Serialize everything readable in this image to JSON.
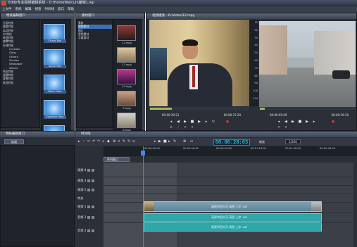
{
  "window": {
    "title": "Edify专业视频编辑系统 - D:\\HomeWatcun\\编辑1.wp"
  },
  "menu": [
    "上文件",
    "系统",
    "编辑",
    "视窗",
    "时间线",
    "窗口",
    "帮助"
  ],
  "effects_panel": {
    "title": "特技编辑窗口",
    "tree": [
      {
        "label": "分层特技",
        "sub": false
      },
      {
        "label": "速度特技",
        "sub": false
      },
      {
        "label": "运动特技",
        "sub": false
      },
      {
        "label": "3D特技",
        "sub": false
      },
      {
        "label": "转场特技",
        "sub": false
      },
      {
        "label": "遮罩特技",
        "sub": false
      },
      {
        "label": "光线特技",
        "sub": false
      },
      {
        "label": "Crystals",
        "sub": true
      },
      {
        "label": "Glass",
        "sub": true
      },
      {
        "label": "Others",
        "sub": true
      },
      {
        "label": "Strokes",
        "sub": true
      },
      {
        "label": "Wallpaper",
        "sub": true
      },
      {
        "label": "Waves",
        "sub": true
      },
      {
        "label": "色彩特技",
        "sub": false
      },
      {
        "label": "滤镜特技",
        "sub": false
      },
      {
        "label": "背景特技",
        "sub": false
      },
      {
        "label": "其他特技",
        "sub": false
      }
    ],
    "thumbs": [
      "Chaos Box",
      "Spiral Ball",
      "Black Hole",
      "Explosion Box",
      ""
    ]
  },
  "material_panel": {
    "title": "素材窗口",
    "tree": [
      {
        "label": "素材",
        "selected": false
      },
      {
        "label": "视频素材",
        "selected": true
      },
      {
        "label": "图片",
        "selected": false
      },
      {
        "label": "音频素材",
        "selected": false
      },
      {
        "label": "字幕素材",
        "selected": false
      }
    ],
    "thumbs": [
      "12.mpg",
      "11.mpg",
      "10.mpg",
      "9.mpg",
      "8.mpg"
    ]
  },
  "preview": {
    "title": "视频播放 - D:\\Video\\12.mpg",
    "left_timecode_in": "00:00:29:21",
    "left_timecode_out": "00:00:37:20",
    "right_timecode_in": "00:00:05:09",
    "right_timecode_out": "00:00:29:16",
    "ruler_ticks": [
      "10",
      "20",
      "30",
      "40",
      "50",
      "60",
      "70",
      "80",
      "90",
      "100",
      "110"
    ],
    "left_progress": 0.22,
    "right_progress": 0.05
  },
  "fx_edit": {
    "title": "特技编辑窗口",
    "tab": "轨道"
  },
  "timeline": {
    "title": "时间线",
    "timecode": "00:00:28:03",
    "zoom_label": "缩放",
    "zoom_value": "1/200",
    "ruler_labels": [
      "00:00:05:00",
      "00:00:28:00",
      "00:00:52:00",
      "00:01:16:00",
      "00:01:40:00",
      "00:02:04:00"
    ],
    "sequence_tab": "序列窗口",
    "tracks": [
      "视频 4",
      "视频 3",
      "视频 2",
      "特技",
      "视频 1",
      "音频 1",
      "音频 2"
    ],
    "clips": {
      "video": "高原华阳大河 高原 上字 .avi",
      "audio1": "高原华阳大河 高原 上字 .avi",
      "audio2": "高原华阳大河 高原 上字 .avi"
    }
  }
}
